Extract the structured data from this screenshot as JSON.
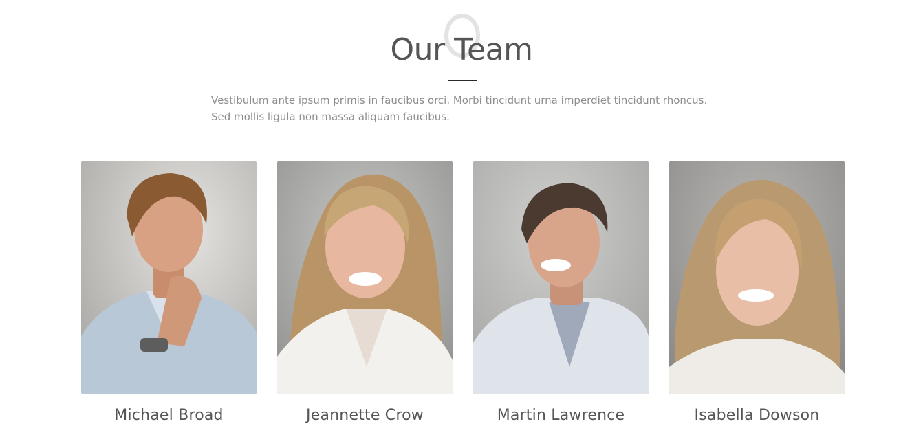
{
  "section": {
    "title": "Our Team",
    "description": "Vestibulum ante ipsum primis in faucibus orci. Morbi tincidunt urna imperdiet tincidunt rhoncus. Sed mollis ligula non massa aliquam faucibus."
  },
  "team": {
    "members": [
      {
        "name": "Michael Broad",
        "photo": "portrait-man-hand-on-chin"
      },
      {
        "name": "Jeannette Crow",
        "photo": "portrait-woman-smiling"
      },
      {
        "name": "Martin Lawrence",
        "photo": "portrait-man-laughing"
      },
      {
        "name": "Isabella Dowson",
        "photo": "portrait-woman-curly-hair"
      }
    ]
  },
  "colors": {
    "title": "#555555",
    "body_text": "#8e8e8e",
    "rule": "#2b2b2b",
    "photo_background": "#c9c9c7"
  }
}
